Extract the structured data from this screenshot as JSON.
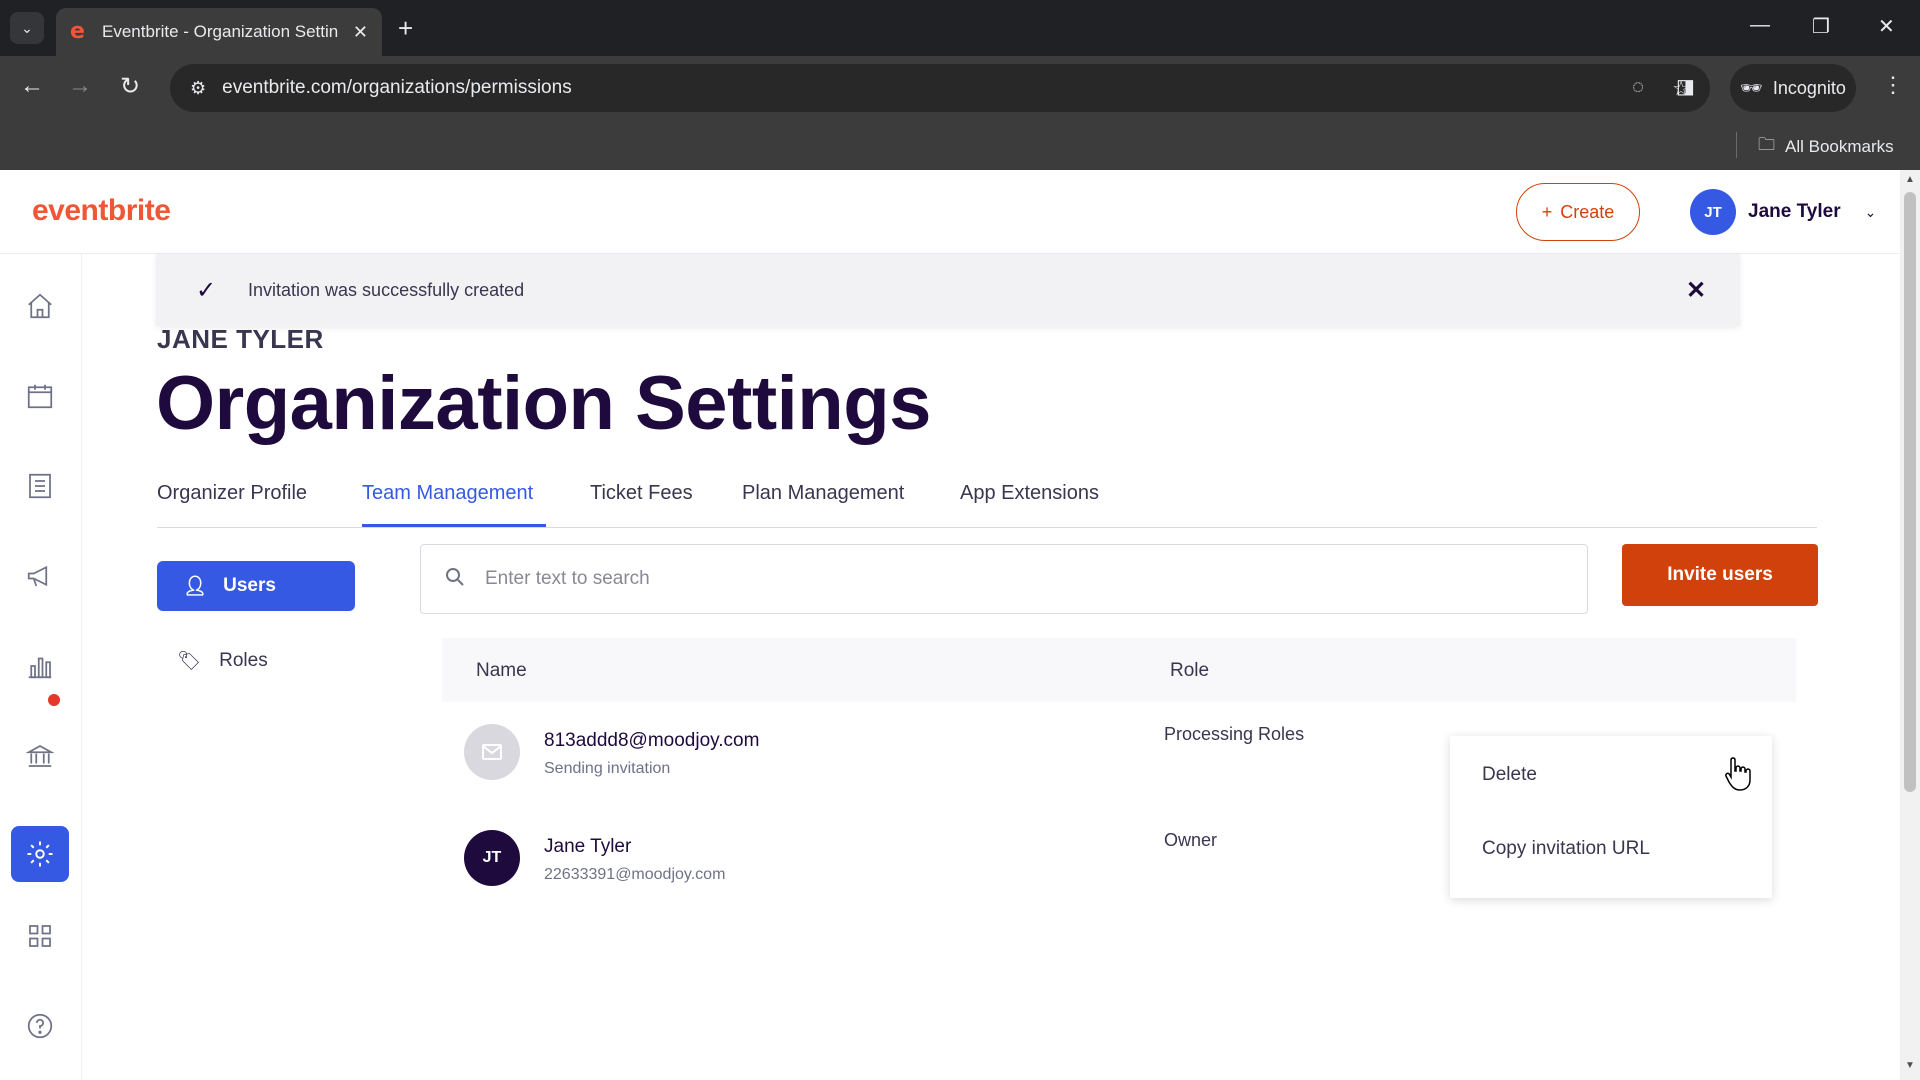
{
  "browser": {
    "tab_title": "Eventbrite - Organization Settin",
    "url": "eventbrite.com/organizations/permissions",
    "incognito_label": "Incognito",
    "bookmarks_label": "All Bookmarks"
  },
  "header": {
    "logo": "eventbrite",
    "create_label": "Create",
    "user_initials": "JT",
    "user_name": "Jane Tyler"
  },
  "toast": {
    "message": "Invitation was successfully created"
  },
  "page": {
    "org_name": "JANE TYLER",
    "title": "Organization Settings"
  },
  "tabs": [
    {
      "label": "Organizer Profile",
      "active": false
    },
    {
      "label": "Team Management",
      "active": true
    },
    {
      "label": "Ticket Fees",
      "active": false
    },
    {
      "label": "Plan Management",
      "active": false
    },
    {
      "label": "App Extensions",
      "active": false
    }
  ],
  "sidebar": {
    "users_label": "Users",
    "roles_label": "Roles"
  },
  "search": {
    "placeholder": "Enter text to search"
  },
  "invite_label": "Invite users",
  "table": {
    "columns": [
      "Name",
      "Role"
    ],
    "rows": [
      {
        "primary": "813addd8@moodjoy.com",
        "secondary": "Sending invitation",
        "role": "Processing Roles",
        "avatar": "mail"
      },
      {
        "primary": "Jane Tyler",
        "secondary": "22633391@moodjoy.com",
        "role": "Owner",
        "avatar": "JT"
      }
    ]
  },
  "context_menu": {
    "items": [
      "Delete",
      "Copy invitation URL"
    ]
  },
  "colors": {
    "brand": "#f05537",
    "primary_blue": "#3659e3",
    "invite_orange": "#d1410c",
    "dark_purple": "#1e0a3c"
  }
}
